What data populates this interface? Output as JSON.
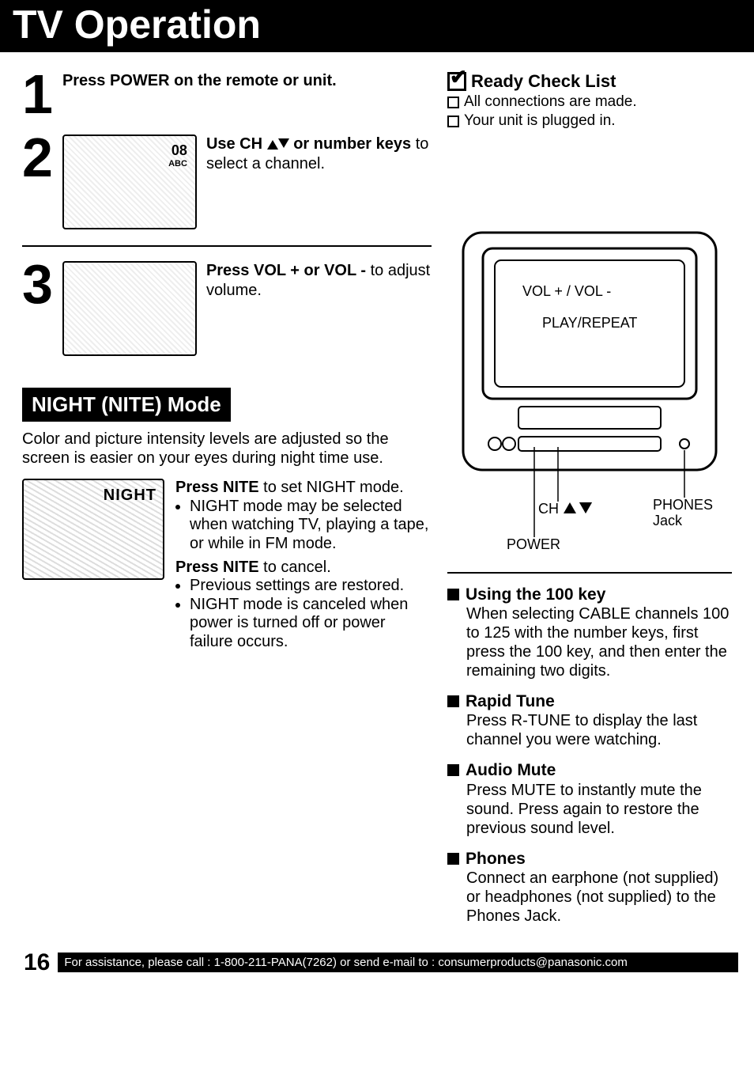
{
  "title": "TV Operation",
  "steps": [
    {
      "num": "1",
      "text_bold": "Press POWER on the remote or unit."
    },
    {
      "num": "2",
      "osd_line1": "08",
      "osd_line2": "ABC",
      "text_before": "Use CH ",
      "text_mid": " or number keys",
      "text_after": " to select a channel."
    },
    {
      "num": "3",
      "text_bold1": "Press VOL + or VOL -",
      "text_after": " to adjust volume."
    }
  ],
  "nite": {
    "header": "NIGHT (NITE) Mode",
    "desc": "Color and picture intensity levels are adjusted so the screen is easier on your eyes during night time use.",
    "img_label": "NIGHT",
    "p1_bold": "Press NITE",
    "p1_rest": " to set NIGHT mode.",
    "b1": "NIGHT mode may be selected when watching TV, playing a tape, or while in FM mode.",
    "p2_bold": "Press NITE",
    "p2_rest": " to cancel.",
    "b2": "Previous settings are restored.",
    "b3": "NIGHT mode is canceled when power is turned off or power failure occurs."
  },
  "checklist": {
    "head": "Ready Check List",
    "items": [
      "All connections are made.",
      "Your unit is plugged in."
    ]
  },
  "diagram": {
    "vol": "VOL + / VOL -",
    "play": "PLAY/REPEAT",
    "ch": "CH",
    "phones": "PHONES Jack",
    "power": "POWER"
  },
  "features": [
    {
      "head": "Using the 100 key",
      "body": "When selecting CABLE channels 100 to 125 with the number keys, first press the 100 key, and then enter the remaining two digits."
    },
    {
      "head": "Rapid Tune",
      "body": "Press R-TUNE to display the last channel you were watching."
    },
    {
      "head": "Audio Mute",
      "body": "Press MUTE to instantly mute the sound. Press again to restore the previous sound level."
    },
    {
      "head": "Phones",
      "body": "Connect an earphone (not supplied) or headphones (not supplied) to the Phones Jack."
    }
  ],
  "footer": {
    "page": "16",
    "bar": "For assistance, please call : 1-800-211-PANA(7262) or send e-mail to : consumerproducts@panasonic.com"
  }
}
